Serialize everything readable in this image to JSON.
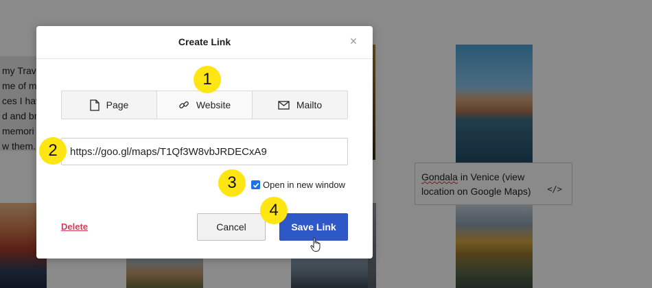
{
  "background": {
    "text_lines": [
      "my Trav",
      "me of m",
      "ces I hav",
      "d and br",
      "memori",
      "w them."
    ],
    "caption": {
      "first_word": "Gondala",
      "rest_line1": " in Venice (view",
      "line2": "location on Google Maps)",
      "code_icon_glyph": "</>"
    }
  },
  "modal": {
    "title": "Create Link",
    "close_glyph": "×",
    "tabs": [
      {
        "label": "Page",
        "icon": "page-icon"
      },
      {
        "label": "Website",
        "icon": "link-icon",
        "active": true
      },
      {
        "label": "Mailto",
        "icon": "mail-icon"
      }
    ],
    "url_value": "https://goo.gl/maps/T1Qf3W8vbJRDECxA9",
    "open_new_window": {
      "label": "Open in new window",
      "checked": true
    },
    "delete_label": "Delete",
    "cancel_label": "Cancel",
    "save_label": "Save Link"
  },
  "steps": [
    "1",
    "2",
    "3",
    "4"
  ],
  "colors": {
    "accent": "#2e57c7",
    "delete": "#d63a55",
    "step_marker": "#ffe511",
    "checkbox": "#1a73e8"
  }
}
